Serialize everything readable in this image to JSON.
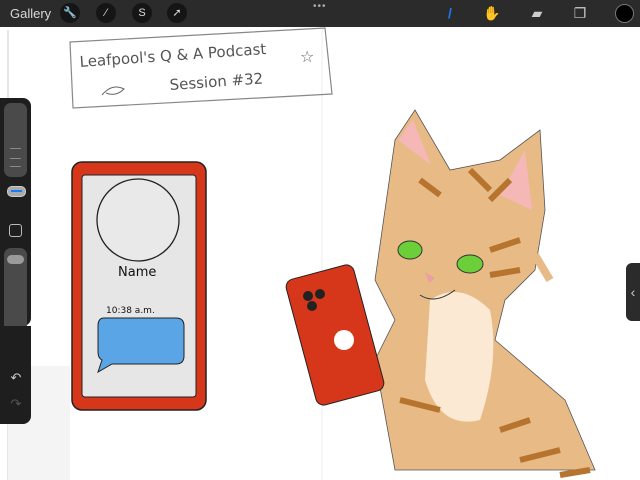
{
  "toolbar": {
    "gallery_label": "Gallery",
    "left_tools": [
      {
        "name": "wrench-icon",
        "glyph": "🔧"
      },
      {
        "name": "magic-wand-icon",
        "glyph": "⁄"
      },
      {
        "name": "selection-icon",
        "glyph": "S"
      },
      {
        "name": "transform-arrow-icon",
        "glyph": "➚"
      }
    ],
    "more": "•••",
    "right_tools": [
      {
        "name": "brush-icon",
        "glyph": "/"
      },
      {
        "name": "smudge-icon",
        "glyph": "✋"
      },
      {
        "name": "eraser-icon",
        "glyph": "▰"
      },
      {
        "name": "layers-icon",
        "glyph": "❐"
      }
    ],
    "active_color": "#000000",
    "accent": "#1a7cf5"
  },
  "sidebar": {
    "undo": "↶",
    "redo": "↷",
    "brush_size": 0.25,
    "opacity": 0.95
  },
  "handle": "‹",
  "canvas": {
    "title_line1": "Leafpool's Q & A Podcast",
    "title_line2": "Session #32",
    "phone_name": "Name",
    "phone_time": "10:38 a.m."
  }
}
